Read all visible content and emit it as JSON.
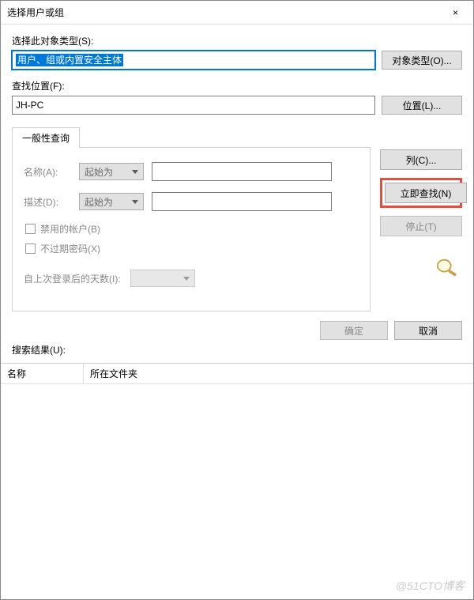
{
  "window": {
    "title": "选择用户或组",
    "close": "×"
  },
  "objectType": {
    "label": "选择此对象类型(S):",
    "value": "用户、组或内置安全主体",
    "button": "对象类型(O)..."
  },
  "location": {
    "label": "查找位置(F):",
    "value": "JH-PC",
    "button": "位置(L)..."
  },
  "tab": {
    "label": "一般性查询"
  },
  "form": {
    "nameLabel": "名称(A):",
    "nameCombo": "起始为",
    "descLabel": "描述(D):",
    "descCombo": "起始为",
    "disabledAccount": "禁用的帐户(B)",
    "noExpirePwd": "不过期密码(X)",
    "daysSinceLogin": "自上次登录后的天数(I):"
  },
  "sideButtons": {
    "columns": "列(C)...",
    "findNow": "立即查找(N)",
    "stop": "停止(T)"
  },
  "footer": {
    "ok": "确定",
    "cancel": "取消"
  },
  "results": {
    "label": "搜索结果(U):",
    "colName": "名称",
    "colFolder": "所在文件夹"
  },
  "watermark": "@51CTO博客"
}
